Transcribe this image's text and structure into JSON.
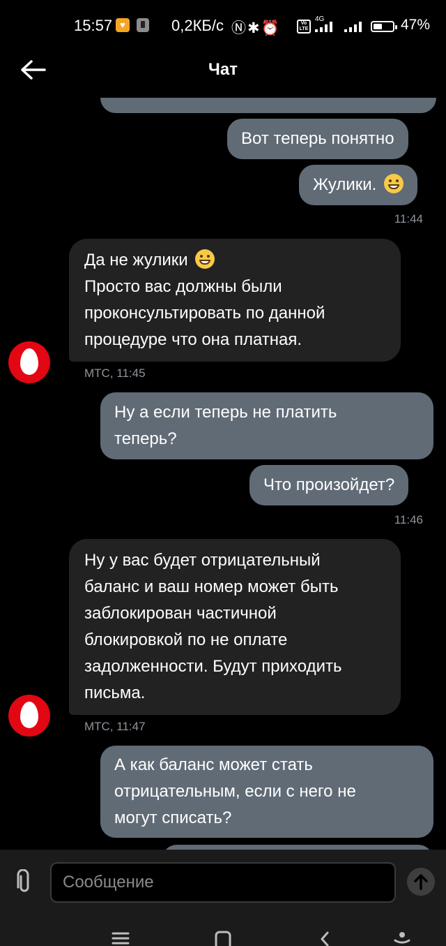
{
  "status_bar": {
    "time": "15:57",
    "net_speed": "0,2КБ/с",
    "battery_percent": "47%",
    "battery_level": 0.47,
    "icons": [
      "app-icon",
      "app-icon",
      "nfc-icon",
      "bluetooth-icon",
      "alarm-icon",
      "volte-icon",
      "signal-icon",
      "signal-icon",
      "battery-icon"
    ]
  },
  "header": {
    "title": "Чат",
    "back_icon": "arrow-left-icon"
  },
  "messages": {
    "m0_text": "",
    "m1_text": "Вот теперь понятно",
    "m2_text": "Жулики.",
    "m2_time": "11:44",
    "m3_lines": [
      "Да не жулики",
      "Просто вас должны были",
      "проконсультировать по данной",
      "процедуре что она платная."
    ],
    "m3_meta": "МТС, 11:45",
    "m4_lines": [
      "Ну а если теперь не платить",
      "теперь?"
    ],
    "m5_text": "Что произойдет?",
    "m5_time": "11:46",
    "m6_lines": [
      "Ну у вас будет отрицательный",
      "баланс и ваш номер может быть",
      "заблокирован частичной",
      "блокировкой по не оплате",
      "задолженности. Будут приходить",
      "письма."
    ],
    "m6_meta": "МТС, 11:47",
    "m7_lines": [
      "А как баланс может стать",
      "отрицательным, если с него не",
      "могут списать?"
    ]
  },
  "composer": {
    "placeholder": "Сообщение",
    "attach_icon": "paperclip-icon",
    "send_icon": "arrow-up-icon"
  },
  "colors": {
    "outgoing_bubble": "#616b76",
    "incoming_bubble": "#222222",
    "brand": "#e30613",
    "background": "#000000"
  }
}
